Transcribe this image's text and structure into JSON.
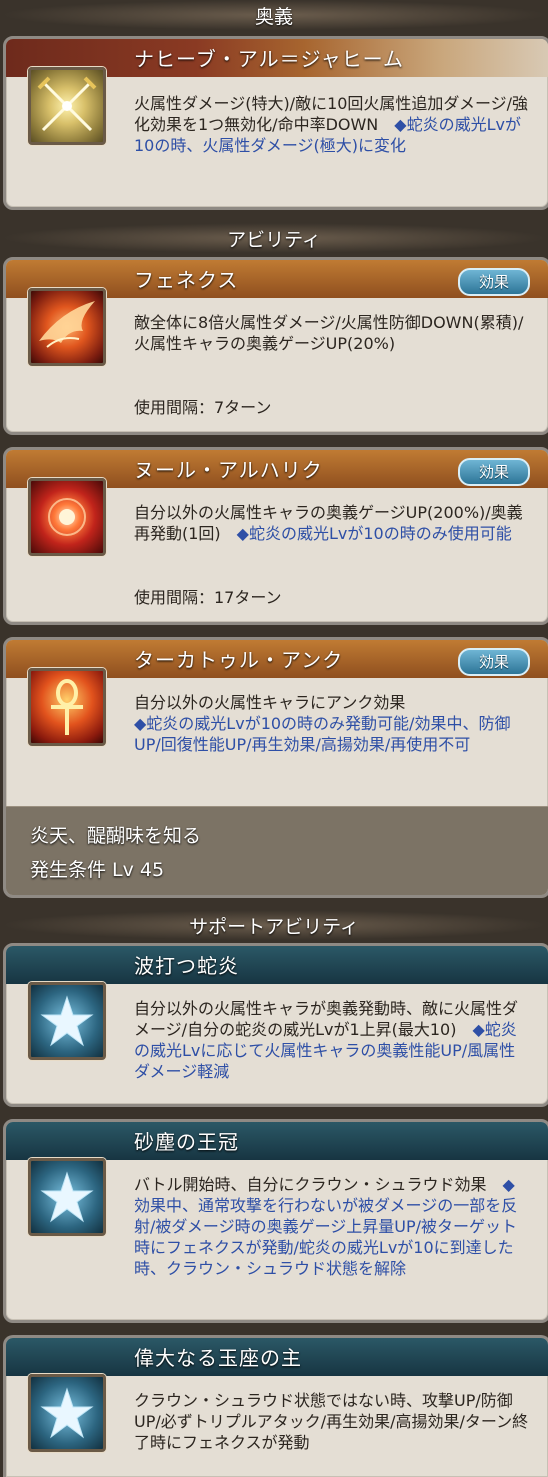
{
  "sections": {
    "ougi": "奥義",
    "ability": "アビリティ",
    "support": "サポートアビリティ"
  },
  "ougi": {
    "name": "ナヒーブ・アル＝ジャヒーム",
    "icon": "crossed-swords-icon",
    "desc_black": "火属性ダメージ(特大)/敵に10回火属性追加ダメージ/強化効果を1つ無効化/命中率DOWN　",
    "desc_blue": "◆蛇炎の威光Lvが10の時、火属性ダメージ(極大)に変化"
  },
  "abilities": [
    {
      "name": "フェネクス",
      "badge": "効果",
      "icon": "phoenix-icon",
      "desc_black": "敵全体に8倍火属性ダメージ/火属性防御DOWN(累積)/火属性キャラの奥義ゲージUP(20%)",
      "desc_blue": "",
      "cooldown": "使用間隔：7ターン"
    },
    {
      "name": "ヌール・アルハリク",
      "badge": "効果",
      "icon": "fire-orb-icon",
      "desc_black": "自分以外の火属性キャラの奥義ゲージUP(200%)/奥義再発動(1回)　",
      "desc_blue": "◆蛇炎の威光Lvが10の時のみ使用可能",
      "cooldown": "使用間隔：17ターン"
    },
    {
      "name": "ターカトゥル・アンク",
      "badge": "効果",
      "icon": "ankh-icon",
      "desc_black": "自分以外の火属性キャラにアンク効果",
      "desc_blue": "◆蛇炎の威光Lvが10の時のみ発動可能/効果中、防御UP/回復性能UP/再生効果/高揚効果/再使用不可",
      "extra_line1": "炎天、醍醐味を知る",
      "extra_line2": "発生条件 Lv 45"
    }
  ],
  "support": [
    {
      "name": "波打つ蛇炎",
      "icon": "star-icon",
      "desc_black": "自分以外の火属性キャラが奥義発動時、敵に火属性ダメージ/自分の蛇炎の威光Lvが1上昇(最大10)　",
      "desc_blue": "◆蛇炎の威光Lvに応じて火属性キャラの奥義性能UP/風属性ダメージ軽減"
    },
    {
      "name": "砂塵の王冠",
      "icon": "star-icon",
      "desc_black": "バトル開始時、自分にクラウン・シュラウド効果　",
      "desc_blue": "◆効果中、通常攻撃を行わないが被ダメージの一部を反射/被ダメージ時の奥義ゲージ上昇量UP/被ターゲット時にフェネクスが発動/蛇炎の威光Lvが10に到達した時、クラウン・シュラウド状態を解除"
    },
    {
      "name": "偉大なる玉座の主",
      "icon": "star-icon",
      "desc_black": "クラウン・シュラウド状態ではない時、攻撃UP/防御UP/必ずトリプルアタック/再生効果/高揚効果/ターン終了時にフェネクスが発動",
      "desc_blue": ""
    }
  ]
}
